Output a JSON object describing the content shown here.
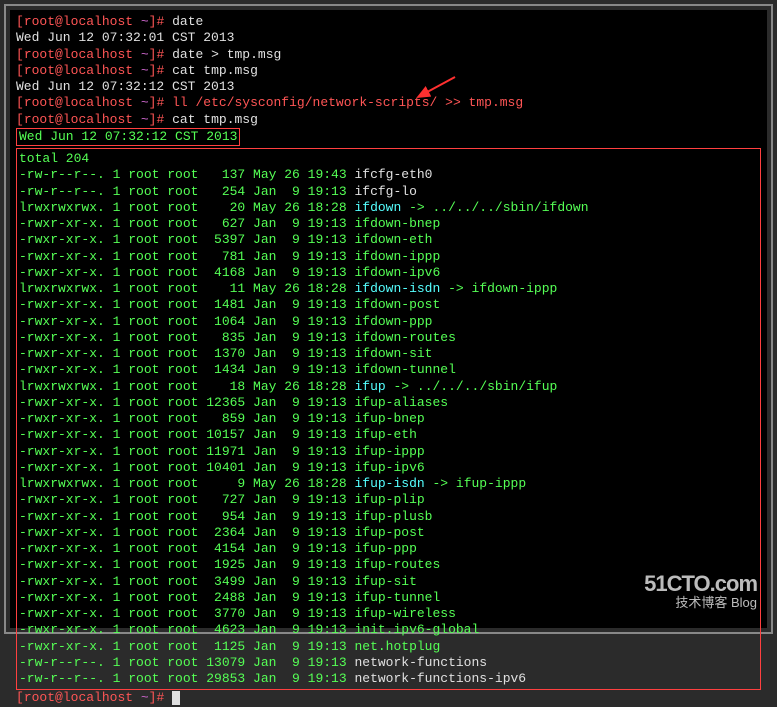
{
  "prompt": {
    "user": "root",
    "at": "@",
    "host": "localhost",
    "tilde": " ~",
    "close": "]#"
  },
  "lines": {
    "cmd1": "date",
    "out1": "Wed Jun 12 07:32:01 CST 2013",
    "cmd2": "date > tmp.msg",
    "cmd3": "cat tmp.msg",
    "out2": "Wed Jun 12 07:32:12 CST 2013",
    "cmd4": "ll /etc/sysconfig/network-scripts/ >> tmp.msg",
    "cmd5": "cat tmp.msg",
    "dateboxed": "Wed Jun 12 07:32:12 CST 2013"
  },
  "listing": {
    "total": "total 204",
    "rows": [
      {
        "perm": "-rw-r--r--. 1 root root",
        "size": "   137",
        "date": " May 26 19:43 ",
        "name": "ifcfg-eth0",
        "cls": "output"
      },
      {
        "perm": "-rw-r--r--. 1 root root",
        "size": "   254",
        "date": " Jan  9 19:13 ",
        "name": "ifcfg-lo",
        "cls": "output"
      },
      {
        "perm": "lrwxrwxrwx. 1 root root",
        "size": "    20",
        "date": " May 26 18:28 ",
        "name": "ifdown",
        "cls": "cyan",
        "link": " -> ../../../sbin/ifdown",
        "linkcls": "green"
      },
      {
        "perm": "-rwxr-xr-x. 1 root root",
        "size": "   627",
        "date": " Jan  9 19:13 ",
        "name": "ifdown-bnep",
        "cls": "green"
      },
      {
        "perm": "-rwxr-xr-x. 1 root root",
        "size": "  5397",
        "date": " Jan  9 19:13 ",
        "name": "ifdown-eth",
        "cls": "green"
      },
      {
        "perm": "-rwxr-xr-x. 1 root root",
        "size": "   781",
        "date": " Jan  9 19:13 ",
        "name": "ifdown-ippp",
        "cls": "green"
      },
      {
        "perm": "-rwxr-xr-x. 1 root root",
        "size": "  4168",
        "date": " Jan  9 19:13 ",
        "name": "ifdown-ipv6",
        "cls": "green"
      },
      {
        "perm": "lrwxrwxrwx. 1 root root",
        "size": "    11",
        "date": " May 26 18:28 ",
        "name": "ifdown-isdn",
        "cls": "cyan",
        "link": " -> ifdown-ippp",
        "linkcls": "green"
      },
      {
        "perm": "-rwxr-xr-x. 1 root root",
        "size": "  1481",
        "date": " Jan  9 19:13 ",
        "name": "ifdown-post",
        "cls": "green"
      },
      {
        "perm": "-rwxr-xr-x. 1 root root",
        "size": "  1064",
        "date": " Jan  9 19:13 ",
        "name": "ifdown-ppp",
        "cls": "green"
      },
      {
        "perm": "-rwxr-xr-x. 1 root root",
        "size": "   835",
        "date": " Jan  9 19:13 ",
        "name": "ifdown-routes",
        "cls": "green"
      },
      {
        "perm": "-rwxr-xr-x. 1 root root",
        "size": "  1370",
        "date": " Jan  9 19:13 ",
        "name": "ifdown-sit",
        "cls": "green"
      },
      {
        "perm": "-rwxr-xr-x. 1 root root",
        "size": "  1434",
        "date": " Jan  9 19:13 ",
        "name": "ifdown-tunnel",
        "cls": "green"
      },
      {
        "perm": "lrwxrwxrwx. 1 root root",
        "size": "    18",
        "date": " May 26 18:28 ",
        "name": "ifup",
        "cls": "cyan",
        "link": " -> ../../../sbin/ifup",
        "linkcls": "green"
      },
      {
        "perm": "-rwxr-xr-x. 1 root root",
        "size": " 12365",
        "date": " Jan  9 19:13 ",
        "name": "ifup-aliases",
        "cls": "green"
      },
      {
        "perm": "-rwxr-xr-x. 1 root root",
        "size": "   859",
        "date": " Jan  9 19:13 ",
        "name": "ifup-bnep",
        "cls": "green"
      },
      {
        "perm": "-rwxr-xr-x. 1 root root",
        "size": " 10157",
        "date": " Jan  9 19:13 ",
        "name": "ifup-eth",
        "cls": "green"
      },
      {
        "perm": "-rwxr-xr-x. 1 root root",
        "size": " 11971",
        "date": " Jan  9 19:13 ",
        "name": "ifup-ippp",
        "cls": "green"
      },
      {
        "perm": "-rwxr-xr-x. 1 root root",
        "size": " 10401",
        "date": " Jan  9 19:13 ",
        "name": "ifup-ipv6",
        "cls": "green"
      },
      {
        "perm": "lrwxrwxrwx. 1 root root",
        "size": "     9",
        "date": " May 26 18:28 ",
        "name": "ifup-isdn",
        "cls": "cyan",
        "link": " -> ifup-ippp",
        "linkcls": "green"
      },
      {
        "perm": "-rwxr-xr-x. 1 root root",
        "size": "   727",
        "date": " Jan  9 19:13 ",
        "name": "ifup-plip",
        "cls": "green"
      },
      {
        "perm": "-rwxr-xr-x. 1 root root",
        "size": "   954",
        "date": " Jan  9 19:13 ",
        "name": "ifup-plusb",
        "cls": "green"
      },
      {
        "perm": "-rwxr-xr-x. 1 root root",
        "size": "  2364",
        "date": " Jan  9 19:13 ",
        "name": "ifup-post",
        "cls": "green"
      },
      {
        "perm": "-rwxr-xr-x. 1 root root",
        "size": "  4154",
        "date": " Jan  9 19:13 ",
        "name": "ifup-ppp",
        "cls": "green"
      },
      {
        "perm": "-rwxr-xr-x. 1 root root",
        "size": "  1925",
        "date": " Jan  9 19:13 ",
        "name": "ifup-routes",
        "cls": "green"
      },
      {
        "perm": "-rwxr-xr-x. 1 root root",
        "size": "  3499",
        "date": " Jan  9 19:13 ",
        "name": "ifup-sit",
        "cls": "green"
      },
      {
        "perm": "-rwxr-xr-x. 1 root root",
        "size": "  2488",
        "date": " Jan  9 19:13 ",
        "name": "ifup-tunnel",
        "cls": "green"
      },
      {
        "perm": "-rwxr-xr-x. 1 root root",
        "size": "  3770",
        "date": " Jan  9 19:13 ",
        "name": "ifup-wireless",
        "cls": "green"
      },
      {
        "perm": "-rwxr-xr-x. 1 root root",
        "size": "  4623",
        "date": " Jan  9 19:13 ",
        "name": "init.ipv6-global",
        "cls": "green"
      },
      {
        "perm": "-rwxr-xr-x. 1 root root",
        "size": "  1125",
        "date": " Jan  9 19:13 ",
        "name": "net.hotplug",
        "cls": "green"
      },
      {
        "perm": "-rw-r--r--. 1 root root",
        "size": " 13079",
        "date": " Jan  9 19:13 ",
        "name": "network-functions",
        "cls": "output"
      },
      {
        "perm": "-rw-r--r--. 1 root root",
        "size": " 29853",
        "date": " Jan  9 19:13 ",
        "name": "network-functions-ipv6",
        "cls": "output"
      }
    ]
  },
  "watermark": {
    "logo": "51CTO.com",
    "sub": "技术博客      Blog"
  }
}
